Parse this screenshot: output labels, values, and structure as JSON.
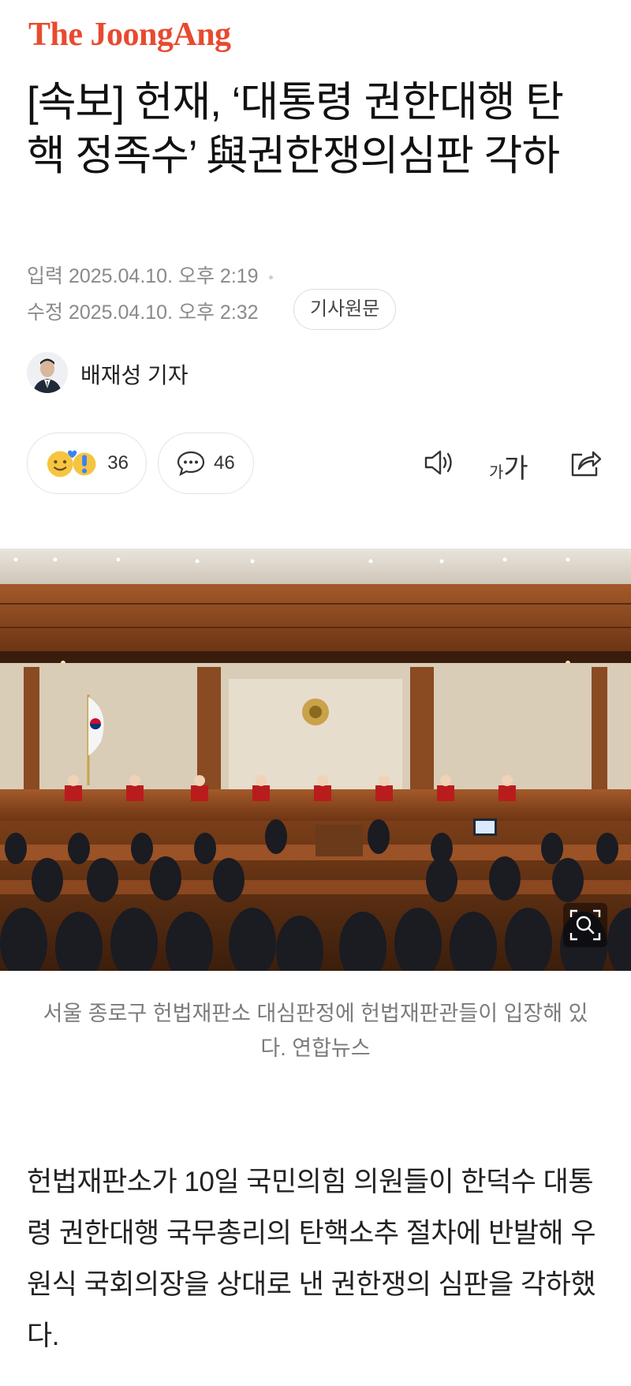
{
  "brand": {
    "logo": "The JoongAng"
  },
  "article": {
    "headline": "[속보] 헌재, ‘대통령 권한대행 탄핵 정족수’ 與권한쟁의심판 각하",
    "published_label": "입력",
    "published": "2025.04.10. 오후 2:19",
    "modified_label": "수정",
    "modified": "2025.04.10. 오후 2:32",
    "source_button": "기사원문",
    "reporter": "배재성 기자",
    "reactions_count": "36",
    "comments_count": "46",
    "font_size_label_small": "가",
    "font_size_label_large": "가",
    "photo_caption": "서울 종로구 헌법재판소 대심판정에 헌법재판관들이 입장해 있다. 연합뉴스",
    "body": "헌법재판소가 10일 국민의힘 의원들이 한덕수 대통령 권한대행 국무총리의 탄핵소추 절차에 반발해 우원식 국회의장을 상대로 낸 권한쟁의 심판을 각하했다."
  },
  "icons": [
    "smile-emoji-icon",
    "exclaim-emoji-icon",
    "comment-icon",
    "speaker-icon",
    "share-icon",
    "zoom-icon"
  ],
  "colors": {
    "brand": "#e84a2f",
    "meta": "#8a8a8a",
    "caption": "#7b7b7b"
  }
}
